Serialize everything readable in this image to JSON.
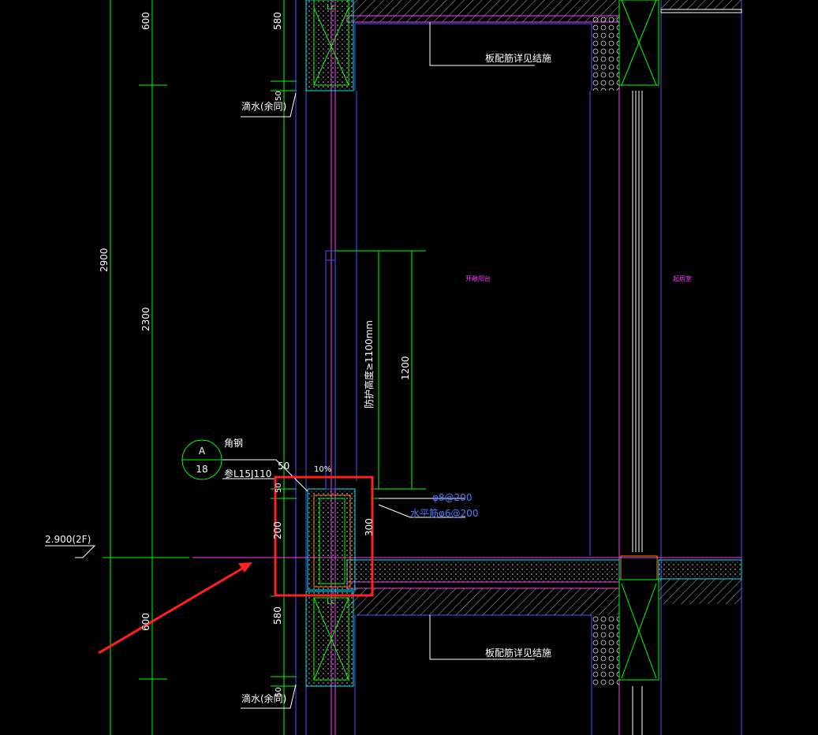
{
  "dimensions": {
    "d600_top": "600",
    "d580_top": "580",
    "d50_top": "50",
    "d2900": "2900",
    "d2300": "2300",
    "d1200": "1200",
    "d50_mid": "50",
    "d50_mid2": "50",
    "d200": "200",
    "d300": "300",
    "d580_bot": "580",
    "d600_bot": "600",
    "d50_bot": "50"
  },
  "labels": {
    "drip_top": "滴水(余同)",
    "drip_bottom": "滴水(余同)",
    "slab_note_top": "板配筋详见结施",
    "slab_note_bottom": "板配筋详见结施",
    "guard_height": "防护高度≥1100mm",
    "angle_steel": "角钢",
    "detail_ref": "参L15J110",
    "slope": "10%",
    "rebar_1": "φ8@200",
    "rebar_2": "水平筋φ6@200",
    "level": "2.900(2F)",
    "room_balcony": "开敞阳台",
    "room_living": "起居室",
    "lc_top": "Lc",
    "lc_bottom": "Lc"
  },
  "detail_callout": {
    "top": "A",
    "bottom": "18"
  },
  "colors": {
    "background": "#000000",
    "wall_green": "#00ff00",
    "structure_cyan": "#00e5ff",
    "outline_blue": "#3b5bff",
    "magenta": "#ff3cff",
    "highlight_red": "#ff2020",
    "text_white": "#ffffff",
    "rebar_blue": "#4a7cff"
  }
}
